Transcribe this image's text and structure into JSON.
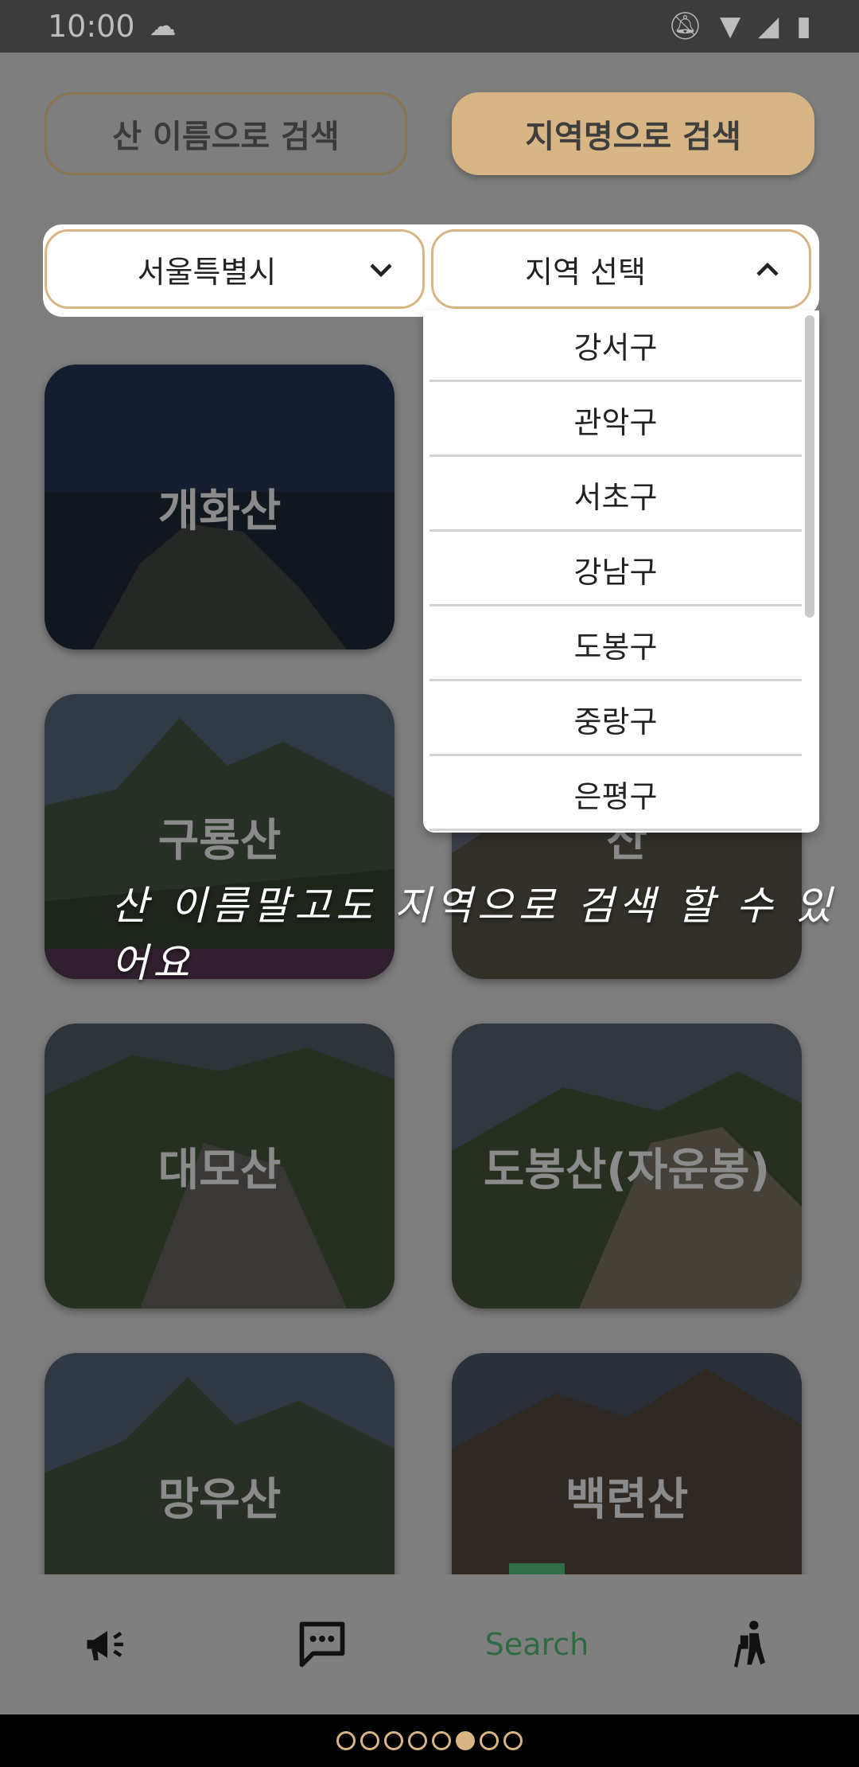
{
  "status_bar": {
    "time": "10:00"
  },
  "search_modes": {
    "by_name": "산 이름으로 검색",
    "by_region": "지역명으로 검색"
  },
  "selects": {
    "city": "서울특별시",
    "district": "지역 선택"
  },
  "district_options": [
    "강서구",
    "관악구",
    "서초구",
    "강남구",
    "도봉구",
    "중랑구",
    "은평구"
  ],
  "mountains": [
    "개화산",
    "구룡산",
    "산",
    "대모산",
    "도봉산(자운봉)",
    "망우산",
    "백련산"
  ],
  "hint_text": "산 이름말고도 지역으로 검색 할 수 있어요",
  "bottom_nav": {
    "search_label": "Search"
  },
  "page_indicator": {
    "count": 8,
    "active_index": 5
  },
  "colors": {
    "accent": "#d8b584",
    "nav_active": "#2e6b43"
  }
}
